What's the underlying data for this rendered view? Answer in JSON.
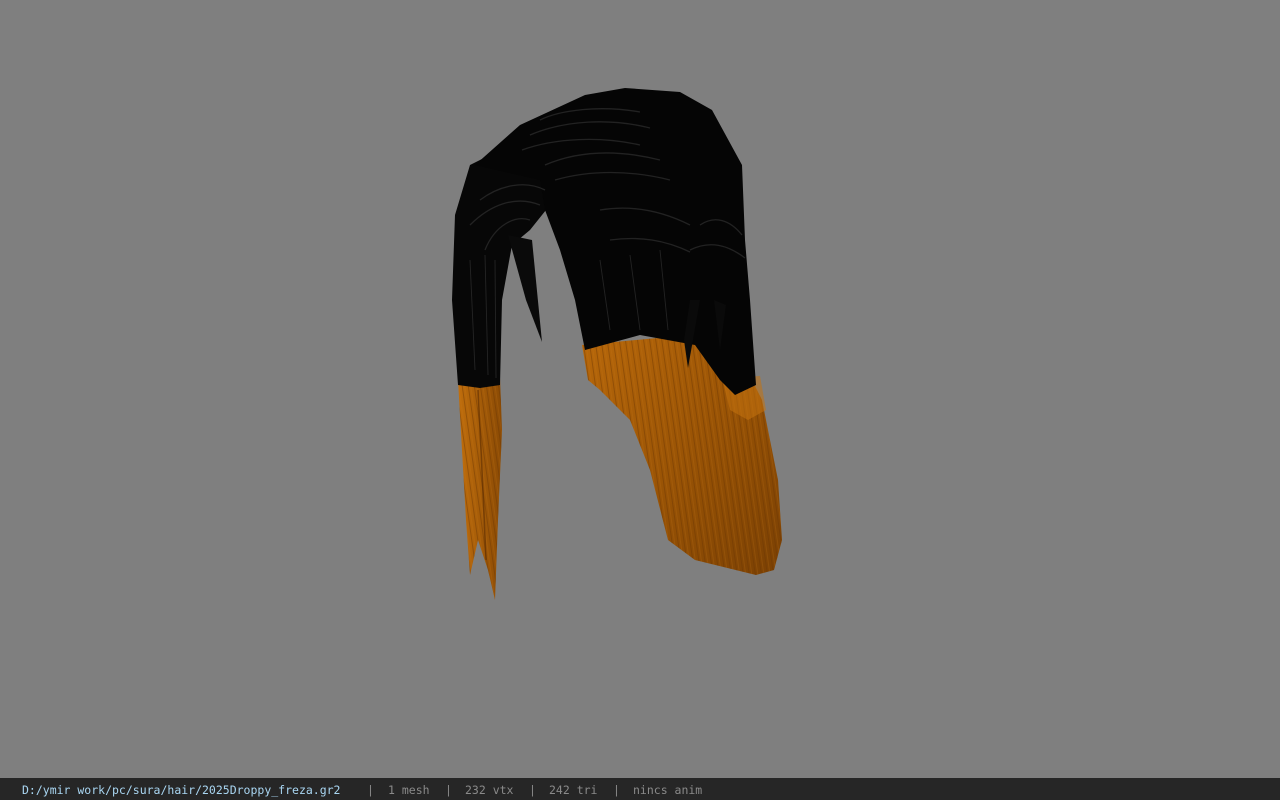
{
  "viewer": {
    "background_color": "#7f7f7f",
    "model": {
      "name": "hair mesh",
      "hair_dark_color": "#050505",
      "hair_tip_color": "#a35a05"
    }
  },
  "status_bar": {
    "file_path": "D:/ymir work/pc/sura/hair/2025Droppy_freza.gr2",
    "separator": "|",
    "mesh_count": "1 mesh",
    "vertex_count": "232 vtx",
    "triangle_count": "242 tri",
    "anim_status": "nincs anim"
  }
}
